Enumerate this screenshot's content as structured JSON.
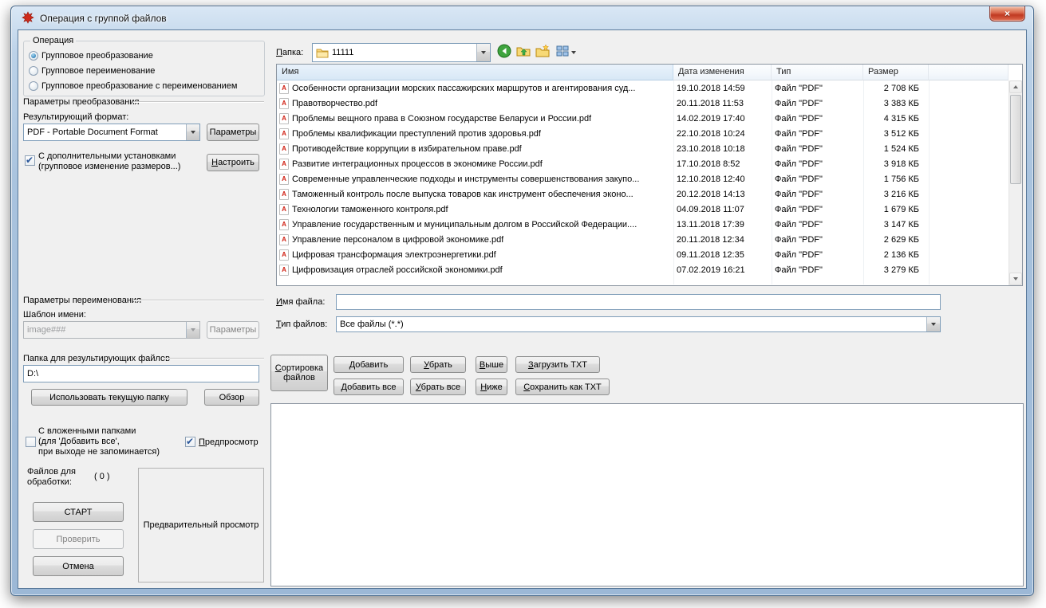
{
  "window": {
    "title": "Операция с группой файлов",
    "close_glyph": "×"
  },
  "operation": {
    "title": "Операция",
    "options": [
      {
        "label": "Групповое преобразование",
        "selected": true
      },
      {
        "label": "Групповое переименование",
        "selected": false
      },
      {
        "label": "Групповое преобразование с переименованием",
        "selected": false
      }
    ]
  },
  "conversion": {
    "section_title": "Параметры преобразования",
    "format_label": "Результирующий формат:",
    "format_value": "PDF - Portable Document Format",
    "params_button": "Параметры",
    "advanced_line1": "С дополнительными установками",
    "advanced_line2": "(групповое изменение размеров...)",
    "configure_button": "Настроить"
  },
  "rename": {
    "section_title": "Параметры переименования",
    "template_label": "Шаблон имени:",
    "template_value": "image###",
    "params_button": "Параметры",
    "output_section_title": "Папка для результирующих файлов",
    "output_path": "D:\\",
    "use_current_button": "Использовать текущую папку",
    "browse_button": "Обзор"
  },
  "toggles": {
    "subfolders_line1": "С вложенными папками",
    "subfolders_line2": "(для 'Добавить все',",
    "subfolders_line3": "при выходе не запоминается)",
    "preview_label": "Предпросмотр"
  },
  "process": {
    "count_line1": "Файлов для",
    "count_line2": "обработки:",
    "count_value": "( 0 )",
    "start_button": "СТАРТ",
    "verify_button": "Проверить",
    "cancel_button": "Отмена",
    "preview_placeholder": "Предварительный просмотр"
  },
  "browser": {
    "folder_label": "Папка:",
    "folder_value": "11111",
    "pdf_icon_glyph": "A",
    "columns": {
      "name": "Имя",
      "date": "Дата изменения",
      "type": "Тип",
      "size": "Размер"
    },
    "files": [
      {
        "name": "Особенности организации морских пассажирских маршрутов и агентирования суд...",
        "date": "19.10.2018 14:59",
        "type": "Файл \"PDF\"",
        "size": "2 708 КБ"
      },
      {
        "name": "Правотворчество.pdf",
        "date": "20.11.2018 11:53",
        "type": "Файл \"PDF\"",
        "size": "3 383 КБ"
      },
      {
        "name": "Проблемы вещного права в Союзном государстве Беларуси и России.pdf",
        "date": "14.02.2019 17:40",
        "type": "Файл \"PDF\"",
        "size": "4 315 КБ"
      },
      {
        "name": "Проблемы квалификации преступлений против здоровья.pdf",
        "date": "22.10.2018 10:24",
        "type": "Файл \"PDF\"",
        "size": "3 512 КБ"
      },
      {
        "name": "Противодействие коррупции в избирательном праве.pdf",
        "date": "23.10.2018 10:18",
        "type": "Файл \"PDF\"",
        "size": "1 524 КБ"
      },
      {
        "name": "Развитие интеграционных процессов в экономике России.pdf",
        "date": "17.10.2018 8:52",
        "type": "Файл \"PDF\"",
        "size": "3 918 КБ"
      },
      {
        "name": "Современные управленческие подходы и инструменты совершенствования закупо...",
        "date": "12.10.2018 12:40",
        "type": "Файл \"PDF\"",
        "size": "1 756 КБ"
      },
      {
        "name": "Таможенный контроль после выпуска товаров как инструмент обеспечения эконо...",
        "date": "20.12.2018 14:13",
        "type": "Файл \"PDF\"",
        "size": "3 216 КБ"
      },
      {
        "name": "Технологии таможенного контроля.pdf",
        "date": "04.09.2018 11:07",
        "type": "Файл \"PDF\"",
        "size": "1 679 КБ"
      },
      {
        "name": "Управление государственным и муниципальным долгом в Российской Федерации....",
        "date": "13.11.2018 17:39",
        "type": "Файл \"PDF\"",
        "size": "3 147 КБ"
      },
      {
        "name": "Управление персоналом в цифровой экономике.pdf",
        "date": "20.11.2018 12:34",
        "type": "Файл \"PDF\"",
        "size": "2 629 КБ"
      },
      {
        "name": "Цифровая трансформация электроэнергетики.pdf",
        "date": "09.11.2018 12:35",
        "type": "Файл \"PDF\"",
        "size": "2 136 КБ"
      },
      {
        "name": "Цифровизация отраслей российской экономики.pdf",
        "date": "07.02.2019 16:21",
        "type": "Файл \"PDF\"",
        "size": "3 279 КБ"
      }
    ],
    "filename_label": "Имя файла:",
    "filename_value": "",
    "filetype_label": "Тип файлов:",
    "filetype_value": "Все файлы (*.*)"
  },
  "queue": {
    "sort_line1": "Сортировка",
    "sort_line2": "файлов",
    "add_button": "Добавить",
    "remove_button": "Убрать",
    "up_button": "Выше",
    "load_txt_button": "Загрузить TXT",
    "add_all_button": "Добавить все",
    "remove_all_button": "Убрать все",
    "down_button": "Ниже",
    "save_txt_button": "Сохранить как TXT"
  }
}
